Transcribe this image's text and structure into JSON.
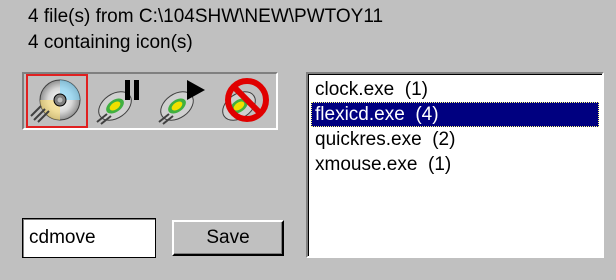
{
  "info": {
    "line1": "4 file(s) from C:\\104SHW\\NEW\\PWTOY11",
    "line2": "4 containing icon(s)"
  },
  "icons": [
    {
      "name": "cd-disc-icon",
      "selected": true
    },
    {
      "name": "cd-disc-pause-icon",
      "selected": false
    },
    {
      "name": "cd-disc-play-icon",
      "selected": false
    },
    {
      "name": "cd-disc-prohibited-icon",
      "selected": false
    }
  ],
  "files": [
    {
      "label": "clock.exe  (1)",
      "selected": false
    },
    {
      "label": "flexicd.exe  (4)",
      "selected": true
    },
    {
      "label": "quickres.exe  (2)",
      "selected": false
    },
    {
      "label": "xmouse.exe  (1)",
      "selected": false
    }
  ],
  "name_input": {
    "value": "cdmove"
  },
  "save_label": "Save",
  "colors": {
    "face": "#c0c0c0",
    "selection": "#000080",
    "icon_highlight": "#e02020"
  }
}
